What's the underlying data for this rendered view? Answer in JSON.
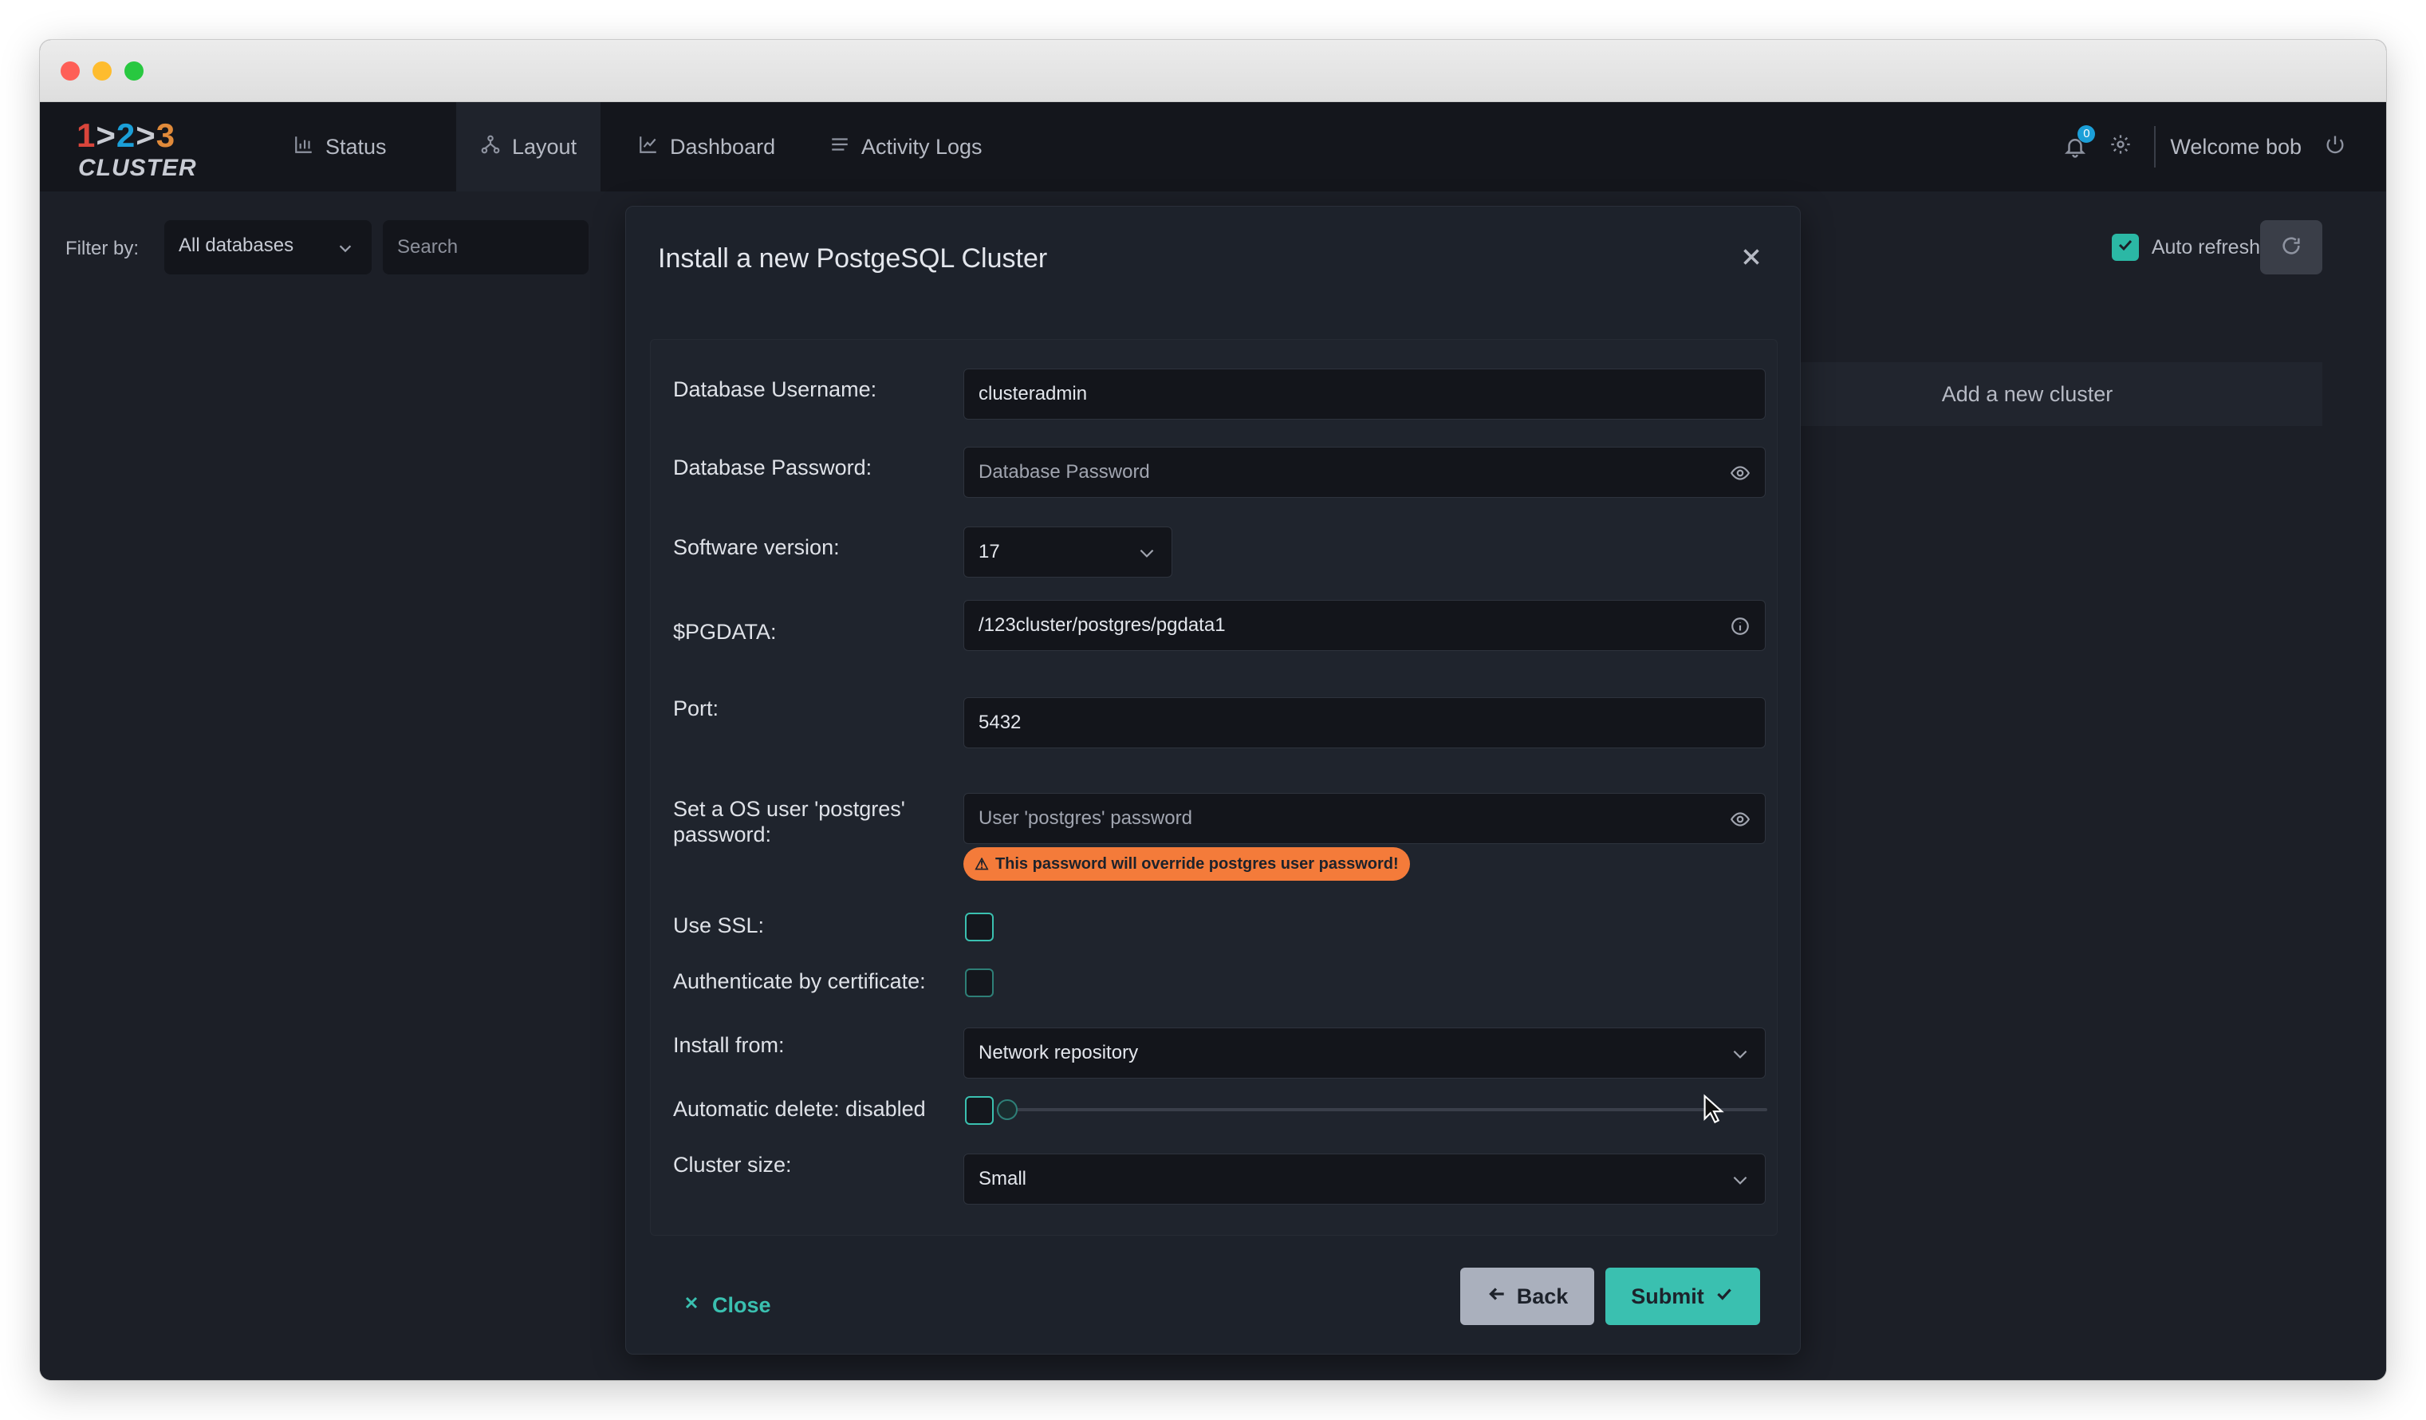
{
  "app": {
    "logo": {
      "digits": [
        "1",
        "2",
        "3"
      ],
      "separators": [
        ">",
        ">"
      ],
      "word": "CLUSTER"
    },
    "nav": {
      "status": "Status",
      "layout": "Layout",
      "dashboard": "Dashboard",
      "activity_logs": "Activity Logs"
    },
    "header": {
      "notifications_count": "0",
      "welcome": "Welcome bob"
    },
    "filter": {
      "label": "Filter by:",
      "database_select": "All databases",
      "search_placeholder": "Search"
    },
    "auto_refresh_label": "Auto refresh",
    "add_cluster_label": "Add a new cluster"
  },
  "modal": {
    "title": "Install a new PostgeSQL Cluster",
    "fields": {
      "db_username": {
        "label": "Database Username:",
        "value": "clusteradmin"
      },
      "db_password": {
        "label": "Database Password:",
        "placeholder": "Database Password"
      },
      "software_version": {
        "label": "Software version:",
        "value": "17"
      },
      "pgdata": {
        "label": "$PGDATA:",
        "value": "/123cluster/postgres/pgdata1"
      },
      "port": {
        "label": "Port:",
        "value": "5432"
      },
      "os_password": {
        "label_line1": "Set a OS user 'postgres'",
        "label_line2": "password:",
        "placeholder": "User 'postgres' password"
      },
      "warning": "This password will override postgres user password!",
      "use_ssl": {
        "label": "Use SSL:"
      },
      "auth_cert": {
        "label": "Authenticate by certificate:"
      },
      "install_from": {
        "label": "Install from:",
        "value": "Network repository"
      },
      "auto_delete": {
        "label": "Automatic delete: disabled"
      },
      "cluster_size": {
        "label": "Cluster size:",
        "value": "Small"
      }
    },
    "buttons": {
      "close": "Close",
      "back": "Back",
      "submit": "Submit"
    }
  },
  "colors": {
    "accent": "#3ac0b0",
    "warning": "#f47b3a",
    "badge": "#1b9fd8"
  }
}
